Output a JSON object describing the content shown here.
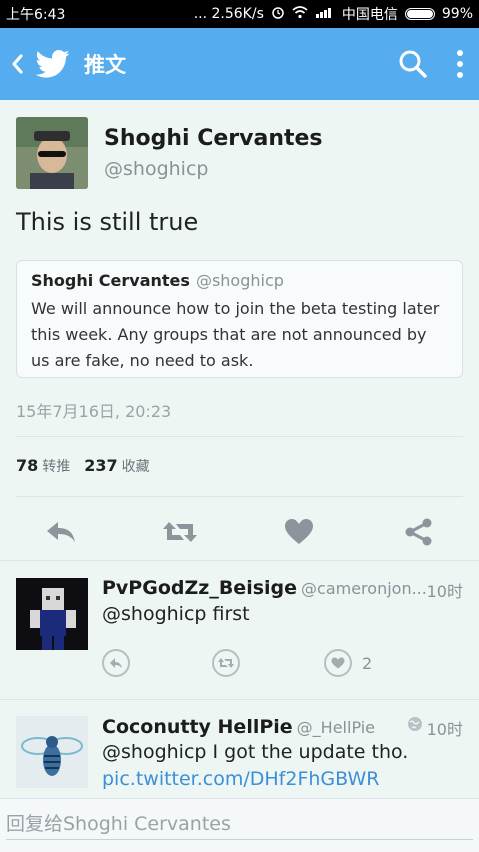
{
  "status_bar": {
    "time": "上午6:43",
    "network_speed": "... 2.56K/s",
    "carrier": "中国电信",
    "battery": "99%",
    "battery_level": 0.99
  },
  "app_bar": {
    "title": "推文",
    "icons": [
      "back-icon",
      "twitter-bird-icon",
      "search-icon",
      "more-vertical-icon"
    ]
  },
  "tweet": {
    "author_name": "Shoghi Cervantes",
    "author_handle": "@shoghicp",
    "text": "This is still true",
    "quote": {
      "name": "Shoghi Cervantes",
      "handle": "@shoghicp",
      "text": "We will announce how to join the beta testing later this week. Any groups that are not announced by us are fake, no need to ask."
    },
    "timestamp": "15年7月16日, 20:23",
    "retweets": "78",
    "retweets_label": "转推",
    "likes": "237",
    "likes_label": "收藏",
    "actions": [
      "reply-icon",
      "retweet-icon",
      "heart-icon",
      "share-icon"
    ]
  },
  "replies": [
    {
      "name": "PvPGodZz_Beisige",
      "handle": "@cameronjon...",
      "time": "10时",
      "text": "@shoghicp first",
      "like_count": "2"
    },
    {
      "name": "Coconutty HellPie",
      "handle": "@_HellPie",
      "time": "10时",
      "text": "@shoghicp I got the update tho.",
      "link": "pic.twitter.com/DHf2FhGBWR"
    }
  ],
  "reply_box": {
    "placeholder": "回复给Shoghi Cervantes"
  },
  "colors": {
    "accent": "#55acee",
    "background": "#eef6f3",
    "link": "#3b8fd6"
  }
}
